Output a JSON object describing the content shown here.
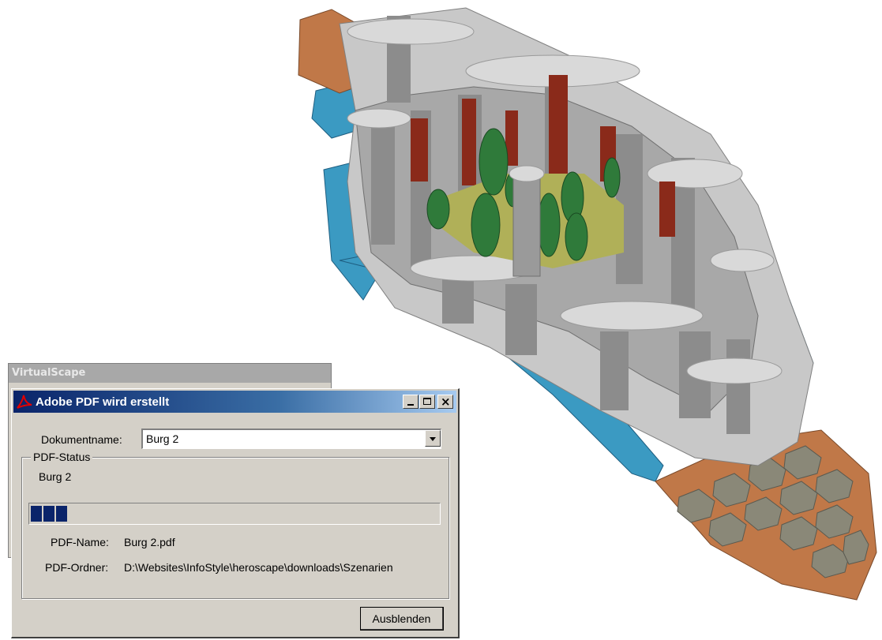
{
  "app": {
    "background_title": "VirtualScape"
  },
  "dialog": {
    "title": "Adobe PDF wird erstellt",
    "icons": [
      "adobe-pdf-icon",
      "minimize-icon",
      "maximize-icon",
      "close-icon"
    ],
    "document_label": "Dokumentname:",
    "document_value": "Burg 2",
    "group_label": "PDF-Status",
    "status_document": "Burg 2",
    "progress_fraction": 0.1,
    "pdf_name_label": "PDF-Name:",
    "pdf_name_value": "Burg 2.pdf",
    "pdf_folder_label": "PDF-Ordner:",
    "pdf_folder_value": "D:\\Websites\\InfoStyle\\heroscape\\downloads\\Szenarien",
    "hide_button": "Ausblenden"
  },
  "colors": {
    "title_gradient_start": "#0a246a",
    "progress": "#0a246a",
    "water": "#3b9ac2",
    "sand": "#c08050",
    "rock_wall": "#9a9a9a",
    "tree": "#2f7a3a",
    "door": "#8a2a1a"
  }
}
